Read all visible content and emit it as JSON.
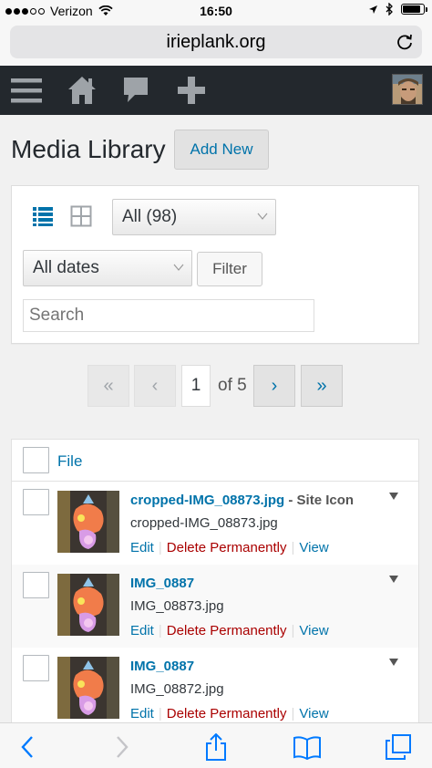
{
  "status": {
    "carrier": "Verizon",
    "time": "16:50"
  },
  "browser": {
    "url": "irieplank.org"
  },
  "page": {
    "title": "Media Library",
    "add_new_label": "Add New"
  },
  "filters": {
    "type_select": "All (98)",
    "date_select": "All dates",
    "filter_label": "Filter",
    "search_placeholder": "Search"
  },
  "pagination": {
    "first": "«",
    "prev": "‹",
    "current": "1",
    "of_total": "of 5",
    "next": "›",
    "last": "»"
  },
  "table": {
    "header_file": "File",
    "rows": [
      {
        "title": "cropped-IMG_08873.jpg",
        "state": " - Site Icon",
        "filename": "cropped-IMG_08873.jpg",
        "edit": "Edit",
        "delete": "Delete Permanently",
        "view": "View"
      },
      {
        "title": "IMG_0887",
        "state": "",
        "filename": "IMG_08873.jpg",
        "edit": "Edit",
        "delete": "Delete Permanently",
        "view": "View"
      },
      {
        "title": "IMG_0887",
        "state": "",
        "filename": "IMG_08872.jpg",
        "edit": "Edit",
        "delete": "Delete Permanently",
        "view": "View"
      }
    ]
  },
  "colors": {
    "admin_bar": "#23282d",
    "link": "#0073aa",
    "delete": "#aa0000",
    "ios_blue": "#007aff"
  }
}
